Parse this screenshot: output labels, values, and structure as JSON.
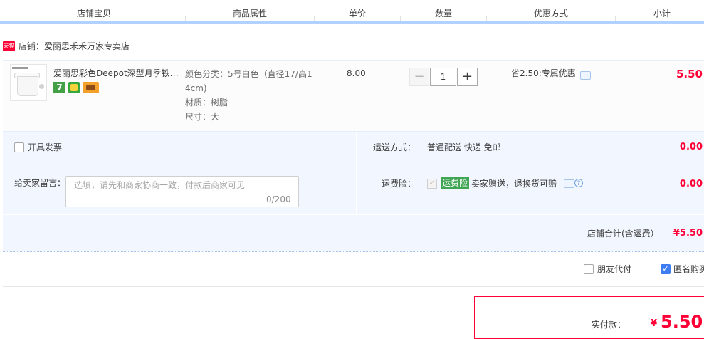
{
  "header": {
    "columns": [
      "店铺宝贝",
      "商品属性",
      "单价",
      "数量",
      "优惠方式",
      "小计"
    ]
  },
  "shop": {
    "tag": "天猫",
    "name": "店铺：爱丽思禾禾万家专卖店"
  },
  "item": {
    "title": "爱丽思彩色Deepot深型月季铁…",
    "badge_seven": "7",
    "attributes": [
      "颜色分类：5号白色（直径17/高1",
      "4cm)",
      "材质：树脂",
      "尺寸：大"
    ],
    "price": "8.00",
    "qty_minus": "−",
    "quantity": "1",
    "qty_plus": "+",
    "discount": "省2.50:专属优惠",
    "subtotal": "5.50"
  },
  "options": {
    "invoice_label": "开具发票",
    "shipping_label": "运送方式：",
    "shipping_value": "普通配送 快递 免邮",
    "shipping_amount": "0.00",
    "message_label": "给卖家留言：",
    "message_placeholder": "选填，请先和商家协商一致，付款后商家可见",
    "message_count": "0/200",
    "insurance_label": "运费险：",
    "insurance_check": "✓",
    "insurance_tag": "运费险",
    "insurance_desc": "卖家赠送，退换货可赔",
    "insurance_help": "?",
    "insurance_amount": "0.00",
    "shop_total_label": "店铺合计(含运费）",
    "shop_total_value": "¥5.50"
  },
  "footer": {
    "friend_pay_label": "朋友代付",
    "anonymous_check": "✓",
    "anonymous_label": "匿名购买",
    "pay_label": "实付款：",
    "pay_currency": "¥",
    "pay_value": "5.50"
  },
  "colors": {
    "accent_red": "#ff0036",
    "header_line": "#b2d1ff",
    "panel_bg": "#f2f7ff",
    "checkbox_blue": "#3e7cf3",
    "insurance_green": "#3fa553"
  }
}
